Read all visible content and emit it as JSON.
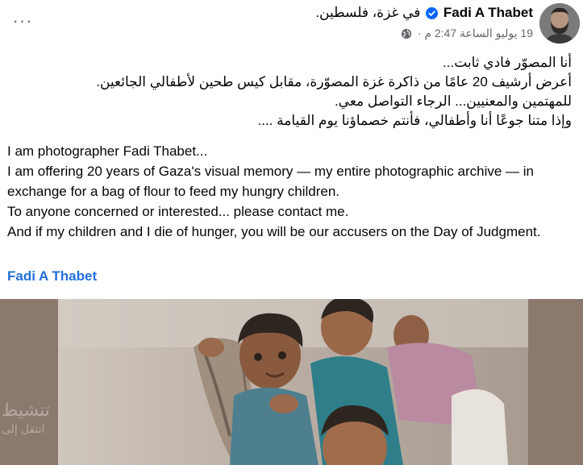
{
  "post": {
    "author_name": "Fadi A Thabet",
    "location_prefix": "في",
    "location": "غزة، فلسطين.",
    "timestamp": "19 يوليو الساعة 2:47 م",
    "separator": "·",
    "more_label": "···",
    "arabic_lines": [
      "أنا المصوّر فادي ثابت...",
      "أعرض أرشيف 20 عامًا من ذاكرة غزة المصوّرة، مقابل كيس طحين لأطفالي الجائعين.",
      "للمهتمين والمعنيين... الرجاء التواصل معي.",
      "وإذا متنا جوعًا أنا وأطفالي، فأنتم خصماؤنا يوم القيامة ...."
    ],
    "english_lines": [
      "I am photographer Fadi Thabet...",
      "I am offering 20 years of Gaza's visual memory — my entire photographic archive — in exchange for a bag of flour to feed my hungry children.",
      "To anyone concerned or interested... please contact me.",
      "And if my children and I die of hunger, you will be our accusers on the Day of Judgment."
    ],
    "author_link": "Fadi A Thabet"
  },
  "watermark": {
    "line1": "تنشيط",
    "line2": "انتقل إلى"
  },
  "colors": {
    "link": "#216fdb",
    "verified": "#0866ff",
    "secondary_text": "#65676b"
  },
  "icons": {
    "more": "more-options-icon",
    "verified": "verified-badge-icon",
    "privacy": "globe-icon"
  }
}
